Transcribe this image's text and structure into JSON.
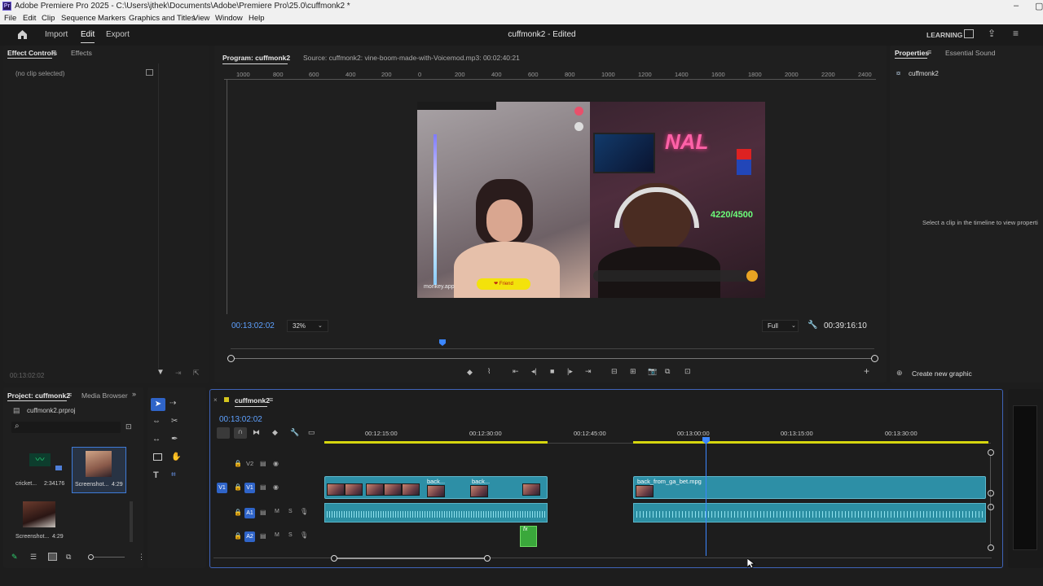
{
  "window": {
    "title": "Adobe Premiere Pro 2025 - C:\\Users\\jthek\\Documents\\Adobe\\Premiere Pro\\25.0\\cuffmonk2 *",
    "app_icon": "Pr"
  },
  "menu": [
    "File",
    "Edit",
    "Clip",
    "Sequence",
    "Markers",
    "Graphics and Titles",
    "View",
    "Window",
    "Help"
  ],
  "header": {
    "nav": [
      "Import",
      "Edit",
      "Export"
    ],
    "active": "Edit",
    "project_title": "cuffmonk2 - Edited",
    "workspace": "LEARNING"
  },
  "effect_controls": {
    "tabs": [
      "Effect Controls",
      "Effects"
    ],
    "message": "(no clip selected)",
    "timecode": "00:13:02:02"
  },
  "program_monitor": {
    "tab": "Program: cuffmonk2",
    "source": "Source: cuffmonk2: vine-boom-made-with-Voicemod.mp3: 00:02:40:21",
    "ruler_h": [
      "1000",
      "800",
      "600",
      "400",
      "200",
      "0",
      "200",
      "400",
      "600",
      "800",
      "1000",
      "1200",
      "1400",
      "1600",
      "1800",
      "2000",
      "2200",
      "2400"
    ],
    "timecode": "00:13:02:02",
    "zoom": "32%",
    "quality": "Full",
    "duration": "00:39:16:10",
    "video_overlay": {
      "counter": "4220/4500",
      "app_label": "monkey.app",
      "button_label": "❤ Friend",
      "neon_sign": "NAL"
    }
  },
  "properties": {
    "tabs": [
      "Properties",
      "Essential Sound"
    ],
    "item": "cuffmonk2",
    "message": "Select a clip in the timeline to view properti",
    "create_button": "Create new graphic"
  },
  "project": {
    "tabs": [
      "Project: cuffmonk2",
      "Media Browser"
    ],
    "file": "cuffmonk2.prproj",
    "items": [
      {
        "name": "cricket...",
        "duration": "2:34176"
      },
      {
        "name": "Screenshot...",
        "duration": "4:29"
      },
      {
        "name": "Screenshot...",
        "duration": "4:29"
      }
    ]
  },
  "timeline": {
    "tab": "cuffmonk2",
    "timecode": "00:13:02:02",
    "ruler": [
      "00:12:15:00",
      "00:12:30:00",
      "00:12:45:00",
      "00:13:00:00",
      "00:13:15:00",
      "00:13:30:00"
    ],
    "tracks": {
      "v2": "V2",
      "v1": "V1",
      "a1": "A1",
      "a2": "A2",
      "source_v": "V1",
      "source_a": "A1"
    },
    "track_letters": {
      "m": "M",
      "s": "S"
    },
    "clip_labels": [
      "back...",
      "back...",
      "back_from_ga_bet.mpg"
    ],
    "fx_label": "fx"
  },
  "colors": {
    "accent": "#2f64c8",
    "timecode_blue": "#5ea1ff",
    "clip_teal": "#2d8fa6",
    "work_area": "#d6d60e"
  }
}
